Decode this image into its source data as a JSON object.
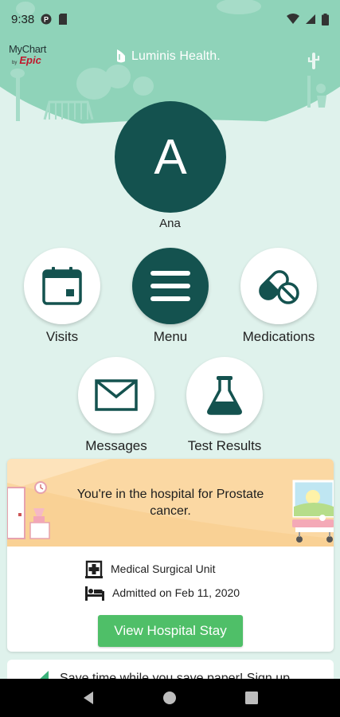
{
  "status_bar": {
    "time": "9:38"
  },
  "header": {
    "mychart_logo": {
      "line1": "MyChart",
      "by": "by",
      "brand": "Epic"
    },
    "brand_name": "Luminis Health."
  },
  "user": {
    "initial": "A",
    "name": "Ana"
  },
  "tiles": [
    {
      "label": "Visits",
      "icon": "calendar-icon"
    },
    {
      "label": "Menu",
      "icon": "hamburger-menu-icon"
    },
    {
      "label": "Medications",
      "icon": "pill-capsule-icon"
    },
    {
      "label": "Messages",
      "icon": "envelope-icon"
    },
    {
      "label": "Test Results",
      "icon": "flask-icon"
    }
  ],
  "hospital_card": {
    "message": "You're in the hospital for Prostate cancer.",
    "unit": "Medical Surgical Unit",
    "admitted": "Admitted on Feb 11, 2020",
    "button_label": "View Hospital Stay"
  },
  "promo_card": {
    "text": "Save time while you save paper! Sign up"
  },
  "colors": {
    "background": "#dff2ec",
    "header_green": "#8fd3b9",
    "dark_teal": "#14524f",
    "button_green": "#4fbf68",
    "banner_peach": "#fbd8a3",
    "epic_red": "#c0172c"
  }
}
